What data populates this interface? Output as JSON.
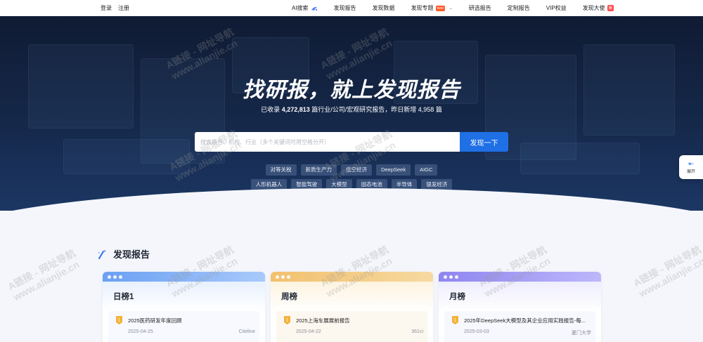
{
  "auth": {
    "login": "登录",
    "register": "注册"
  },
  "nav": [
    {
      "label": "AI搜索",
      "icon": "ai-sparkle-icon"
    },
    {
      "label": "发现报告"
    },
    {
      "label": "发现数据"
    },
    {
      "label": "发现专题",
      "badge": "new",
      "dropdown": true
    },
    {
      "label": "研选报告"
    },
    {
      "label": "定制报告"
    },
    {
      "label": "VIP权益"
    },
    {
      "label": "发现大使",
      "badge": "赚"
    }
  ],
  "hero": {
    "title": "找研报，就上发现报告",
    "sub_prefix": "已收录",
    "sub_count": "4,272,813",
    "sub_mid": "篇行业/公司/宏观研究报告，昨日新增",
    "sub_new": "4,958",
    "sub_suffix": "篇"
  },
  "search": {
    "placeholder": "搜索报告、机构、行业（多个关键词可用空格分开）",
    "button": "发现一下"
  },
  "tags_row1": [
    "对等关税",
    "新质生产力",
    "低空经济",
    "DeepSeek",
    "AIGC"
  ],
  "tags_row2": [
    "人形机器人",
    "智能驾驶",
    "大模型",
    "固态电池",
    "半导体",
    "银发经济"
  ],
  "side_button": {
    "label": "展开"
  },
  "section": {
    "title": "发现报告"
  },
  "cards": [
    {
      "title": "日榜1",
      "item": {
        "rank": "1",
        "title": "2025医药研发年度回顾",
        "date": "2025-04-25",
        "source": "Citeline"
      }
    },
    {
      "title": "周榜",
      "item": {
        "rank": "1",
        "title": "2025上海车展展前报告",
        "date": "2025-04-22",
        "source": "361ci"
      }
    },
    {
      "title": "月榜",
      "item": {
        "rank": "1",
        "title": "2025年DeepSeek大模型及其企业应用实践报告-每...",
        "date": "2025-03-03",
        "source": "厦门大学"
      }
    }
  ],
  "watermark": {
    "line1": "A链接 - 网址导航",
    "line2": "www.alianjie.cn"
  },
  "colors": {
    "primary": "#1f6fe5",
    "hero_bg": "#14264a",
    "badge": "#ff5a2c"
  }
}
